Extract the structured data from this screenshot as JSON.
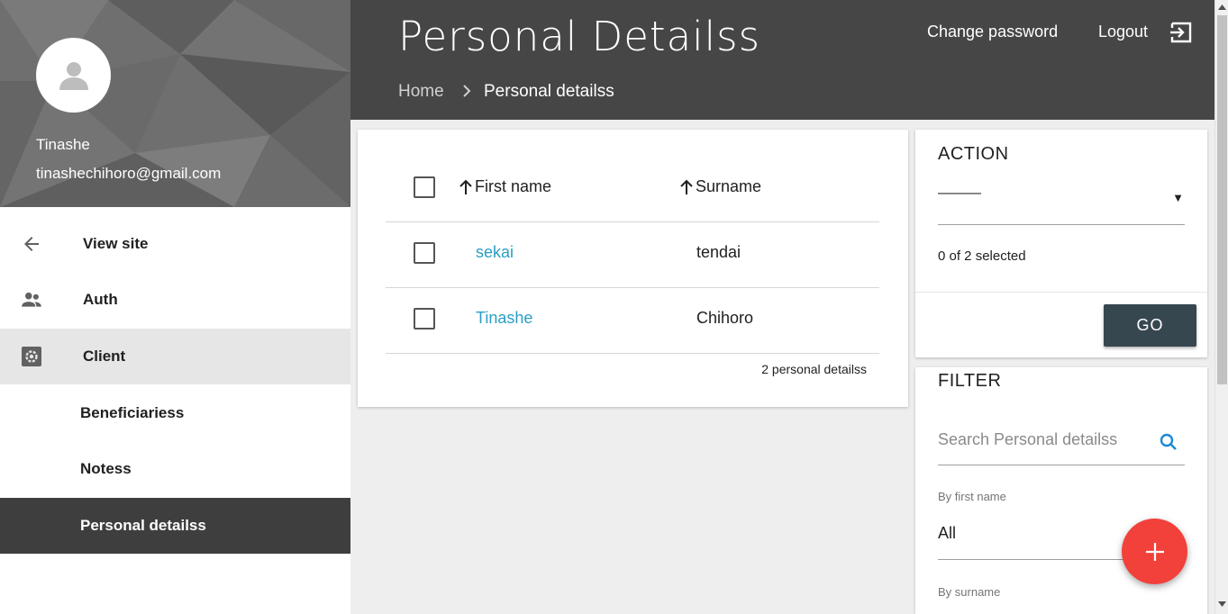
{
  "sidebar": {
    "user": {
      "name": "Tinashe",
      "email": "tinashechihoro@gmail.com",
      "avatar_icon": "person-icon"
    },
    "nav": [
      {
        "label": "View site",
        "icon": "arrow-left-icon"
      },
      {
        "label": "Auth",
        "icon": "people-icon"
      },
      {
        "label": "Client",
        "icon": "settings-icon",
        "selected": true
      },
      {
        "label": "Beneficiariess"
      },
      {
        "label": "Notess"
      },
      {
        "label": "Personal detailss",
        "active": true
      }
    ]
  },
  "header": {
    "title": "Personal Detailss",
    "breadcrumb": {
      "home": "Home",
      "current": "Personal detailss"
    },
    "change_password": "Change password",
    "logout": "Logout"
  },
  "table": {
    "columns": [
      "First name",
      "Surname"
    ],
    "rows": [
      {
        "first_name": "sekai",
        "surname": "tendai"
      },
      {
        "first_name": "Tinashe",
        "surname": "Chihoro"
      }
    ],
    "count_label": "2 personal detailss"
  },
  "action": {
    "title": "ACTION",
    "selected_value": "———",
    "caret": "▼",
    "selected_count": "0 of 2 selected",
    "go_label": "GO"
  },
  "filter": {
    "title": "FILTER",
    "search_placeholder": "Search Personal detailss",
    "by_first_name_label": "By first name",
    "by_first_name_value": "All",
    "by_surname_label": "By surname"
  },
  "colors": {
    "header_bg": "#464646",
    "active_nav_bg": "#3e3e3e",
    "link": "#2a9fc4",
    "go_button": "#37474f",
    "fab": "#f2413a"
  }
}
